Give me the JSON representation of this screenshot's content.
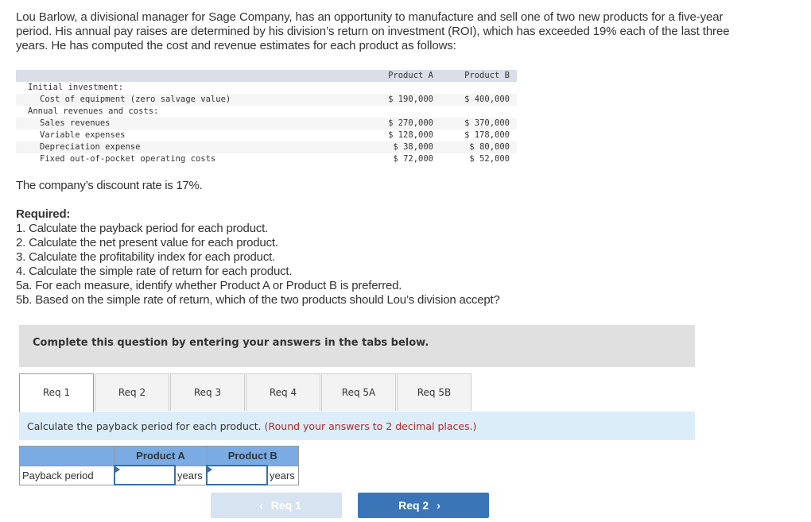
{
  "intro": "Lou Barlow, a divisional manager for Sage Company, has an opportunity to manufacture and sell one of two new products for a five-year period. His annual pay raises are determined by his division’s return on investment (ROI), which has exceeded 19% each of the last three years. He has computed the cost and revenue estimates for each product as follows:",
  "cost_table": {
    "headers": [
      "Product A",
      "Product B"
    ],
    "rows": [
      {
        "label": "Initial investment:",
        "a": "",
        "b": ""
      },
      {
        "label": "Cost of equipment (zero salvage value)",
        "a": "$ 190,000",
        "b": "$ 400,000"
      },
      {
        "label": "Annual revenues and costs:",
        "a": "",
        "b": ""
      },
      {
        "label": "Sales revenues",
        "a": "$ 270,000",
        "b": "$ 370,000"
      },
      {
        "label": "Variable expenses",
        "a": "$ 128,000",
        "b": "$ 178,000"
      },
      {
        "label": "Depreciation expense",
        "a": "$ 38,000",
        "b": "$ 80,000"
      },
      {
        "label": "Fixed out-of-pocket operating costs",
        "a": "$ 72,000",
        "b": "$ 52,000"
      }
    ]
  },
  "discount_text": "The company’s discount rate is 17%.",
  "required": {
    "heading": "Required:",
    "items": [
      "1. Calculate the payback period for each product.",
      "2. Calculate the net present value for each product.",
      "3. Calculate the profitability index for each product.",
      "4. Calculate the simple rate of return for each product.",
      "5a. For each measure, identify whether Product A or Product B is preferred.",
      "5b. Based on the simple rate of return, which of the two products should Lou’s division accept?"
    ]
  },
  "instruction": "Complete this question by entering your answers in the tabs below.",
  "tabs": [
    {
      "label": "Req 1",
      "active": true
    },
    {
      "label": "Req 2",
      "active": false
    },
    {
      "label": "Req 3",
      "active": false
    },
    {
      "label": "Req 4",
      "active": false
    },
    {
      "label": "Req 5A",
      "active": false
    },
    {
      "label": "Req 5B",
      "active": false
    }
  ],
  "prompt": {
    "text": "Calculate the payback period for each product.",
    "hint": "(Round your answers to 2 decimal places.)"
  },
  "answer_table": {
    "headers": [
      "Product A",
      "Product B"
    ],
    "row_label": "Payback period",
    "value_a": "",
    "value_b": "",
    "unit": "years"
  },
  "nav": {
    "prev_label": "Req 1",
    "next_label": "Req 2",
    "prev_icon": "‹",
    "next_icon": "›"
  },
  "colors": {
    "accent": "#3a75b8",
    "hint": "#b0272e",
    "header_blue": "#7aace3",
    "prompt_bg": "#dbedf9"
  }
}
